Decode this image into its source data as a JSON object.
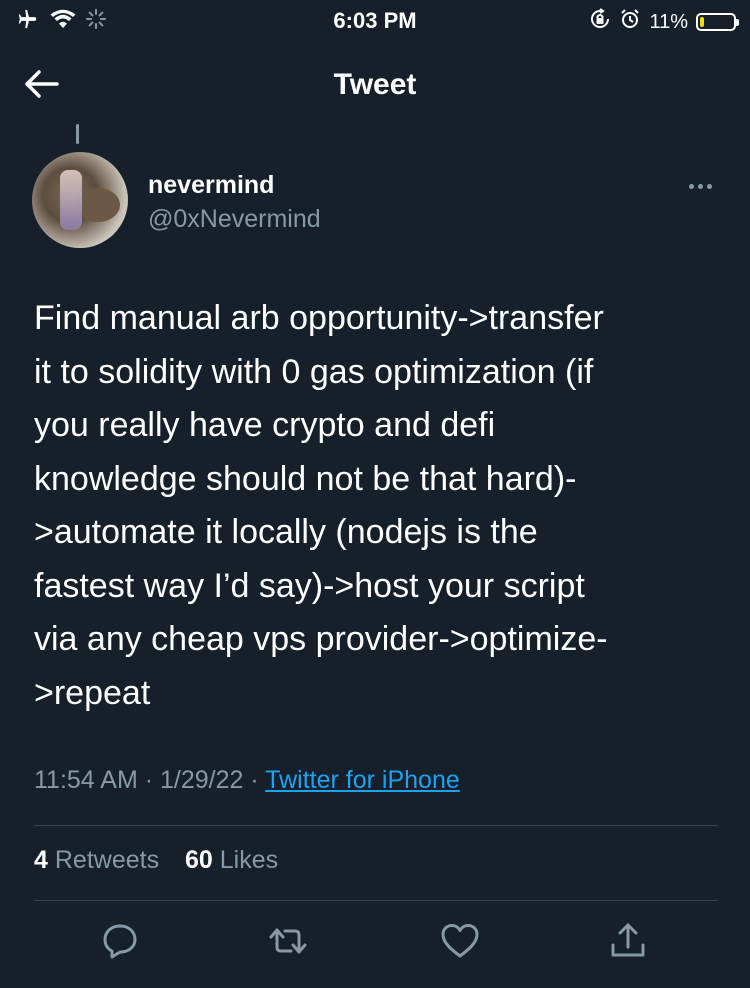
{
  "status_bar": {
    "time": "6:03 PM",
    "battery_percent": "11%",
    "battery_level": 0.11,
    "battery_color": "#f5d90a"
  },
  "header": {
    "title": "Tweet",
    "back_icon": "arrow-left-icon"
  },
  "tweet": {
    "author_name": "nevermind",
    "author_handle": "@0xNevermind",
    "text_lines": [
      "Find manual arb opportunity->transfer",
      "it to solidity with 0 gas optimization (if",
      "you really have crypto and defi",
      "knowledge should not be that hard)-",
      ">automate it locally (nodejs is the",
      "fastest way I’d say)->host your script",
      "via any cheap vps provider->optimize-",
      ">repeat"
    ],
    "time": "11:54 AM",
    "date": "1/29/22",
    "source": "Twitter for iPhone",
    "retweets_count": "4",
    "retweets_label": "Retweets",
    "likes_count": "60",
    "likes_label": "Likes"
  },
  "actions": {
    "reply_icon": "comment-icon",
    "retweet_icon": "retweet-icon",
    "like_icon": "heart-icon",
    "share_icon": "share-icon"
  },
  "colors": {
    "background": "#15202b",
    "secondary_text": "#8899a6",
    "link": "#1da1f2",
    "divider": "#38444d"
  }
}
